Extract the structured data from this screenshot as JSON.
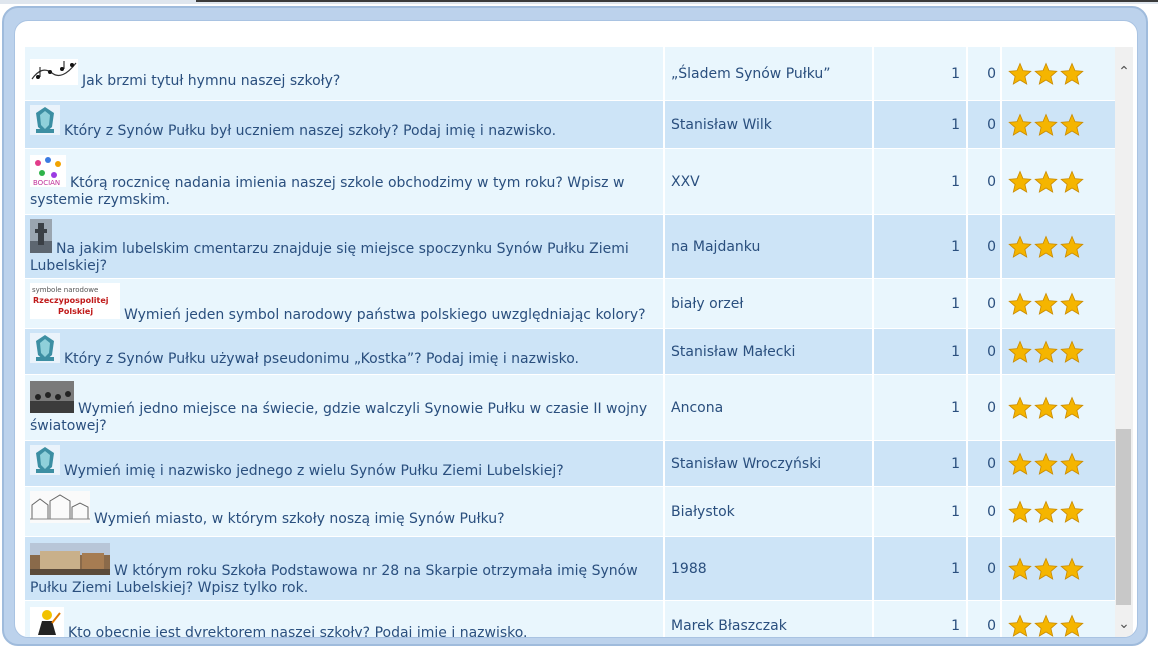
{
  "colors": {
    "row_light": "#e9f6fd",
    "row_dark": "#cde4f7",
    "text": "#2a4f7e",
    "star": "#f5b500"
  },
  "rows": [
    {
      "question": "Jak brzmi tytuł hymnu naszej szkoły?",
      "answer": "„Śladem Synów Pułku”",
      "count1": "1",
      "count2": "0",
      "stars": 3,
      "thumb": "sheet-music-icon"
    },
    {
      "question": "Który z Synów Pułku był uczniem naszej szkoły? Podaj imię i nazwisko.",
      "answer": "Stanisław Wilk",
      "count1": "1",
      "count2": "0",
      "stars": 3,
      "thumb": "emblem-icon"
    },
    {
      "question": "Którą rocznicę nadania imienia naszej szkole obchodzimy w tym roku? Wpisz w systemie rzymskim.",
      "answer": "XXV",
      "count1": "1",
      "count2": "0",
      "stars": 3,
      "thumb": "colorful-logo-icon"
    },
    {
      "question": "Na jakim lubelskim cmentarzu znajduje się miejsce spoczynku Synów Pułku Ziemi Lubelskiej?",
      "answer": "na Majdanku",
      "count1": "1",
      "count2": "0",
      "stars": 3,
      "thumb": "monument-photo-icon"
    },
    {
      "question": "Wymień jeden symbol narodowy państwa polskiego uwzględniając kolory?",
      "answer": "biały orzeł",
      "count1": "1",
      "count2": "0",
      "stars": 3,
      "thumb": "national-symbols-icon",
      "thumb_lines": [
        "symbole narodowe",
        "Rzeczypospolitej",
        "Polskiej"
      ]
    },
    {
      "question": "Który z Synów Pułku używał pseudonimu „Kostka”? Podaj imię i nazwisko.",
      "answer": "Stanisław Małecki",
      "count1": "1",
      "count2": "0",
      "stars": 3,
      "thumb": "emblem-icon"
    },
    {
      "question": "Wymień jedno miejsce na świecie, gdzie walczyli Synowie Pułku w czasie II wojny światowej?",
      "answer": "Ancona",
      "count1": "1",
      "count2": "0",
      "stars": 3,
      "thumb": "war-photo-icon"
    },
    {
      "question": "Wymień imię i nazwisko jednego z wielu Synów Pułku Ziemi Lubelskiej?",
      "answer": "Stanisław Wroczyński",
      "count1": "1",
      "count2": "0",
      "stars": 3,
      "thumb": "emblem-icon"
    },
    {
      "question": "Wymień miasto, w którym szkoły noszą imię Synów Pułku?",
      "answer": "Białystok",
      "count1": "1",
      "count2": "0",
      "stars": 3,
      "thumb": "city-sketch-icon"
    },
    {
      "question": "W którym roku Szkoła Podstawowa nr 28 na Skarpie otrzymała imię Synów Pułku Ziemi Lubelskiej? Wpisz tylko rok.",
      "answer": "1988",
      "count1": "1",
      "count2": "0",
      "stars": 3,
      "thumb": "school-photo-icon"
    },
    {
      "question": "Kto obecnie jest dyrektorem naszej szkoły? Podaj imię i nazwisko.",
      "answer": "Marek Błaszczak",
      "count1": "1",
      "count2": "0",
      "stars": 3,
      "thumb": "director-cartoon-icon"
    }
  ]
}
